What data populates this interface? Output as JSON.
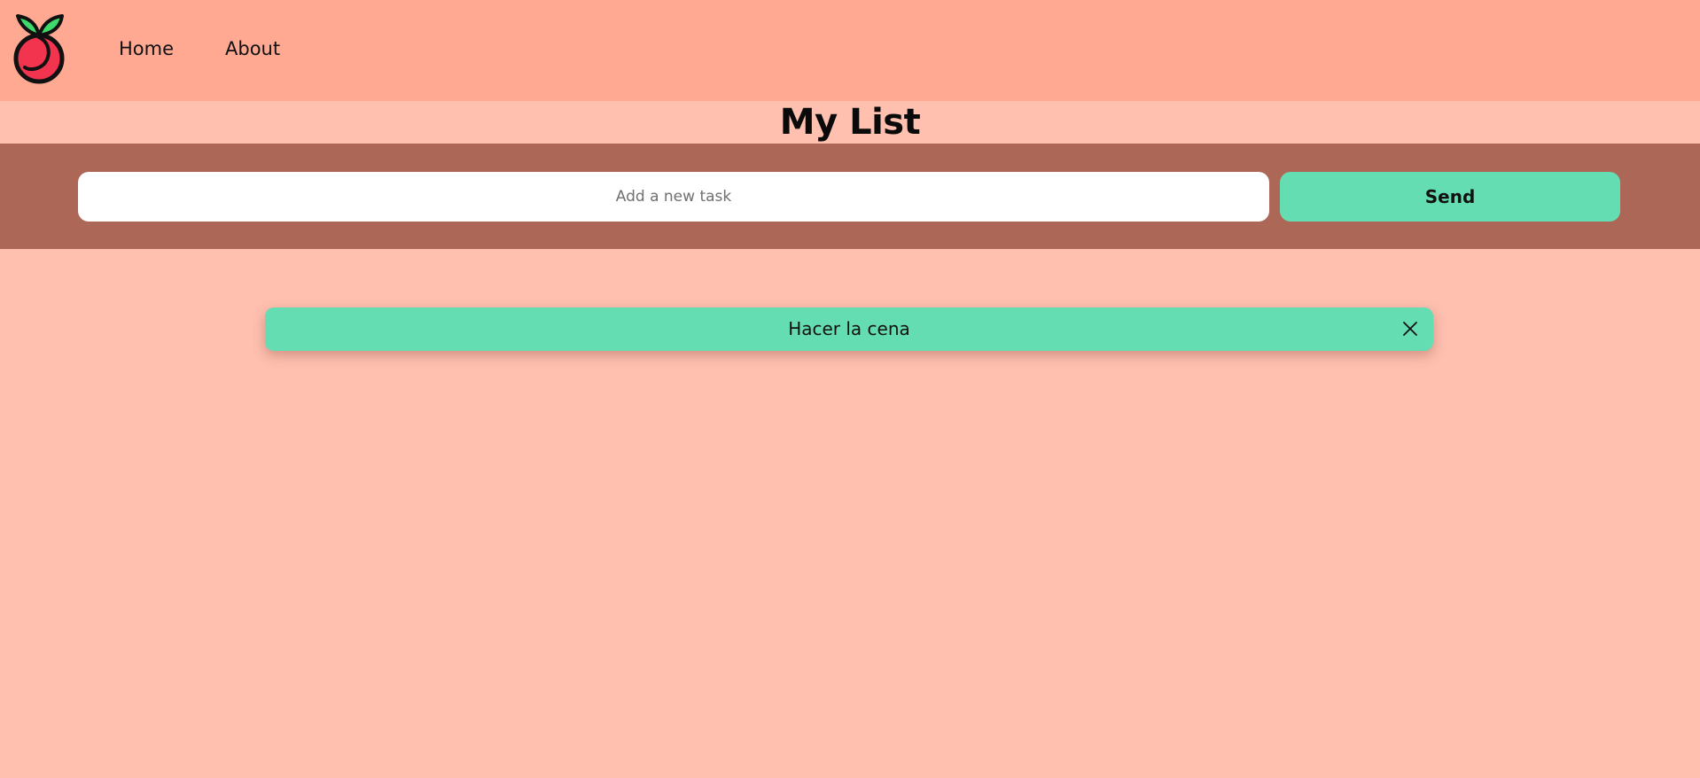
{
  "nav": {
    "logo_icon": "cherry-logo-icon",
    "links": [
      {
        "label": "Home"
      },
      {
        "label": "About"
      }
    ]
  },
  "header": {
    "title": "My List"
  },
  "form": {
    "input_placeholder": "Add a new task",
    "input_value": "",
    "send_label": "Send"
  },
  "tasks": [
    {
      "text": "Hacer la cena",
      "delete_icon": "close-icon"
    }
  ],
  "colors": {
    "navbar_bg": "#FFA892",
    "page_bg": "#FFC0B0",
    "input_band_bg": "#AD6757",
    "accent_green": "#65DDB3",
    "logo_red": "#F2344F",
    "logo_leaf": "#3FD86B"
  }
}
